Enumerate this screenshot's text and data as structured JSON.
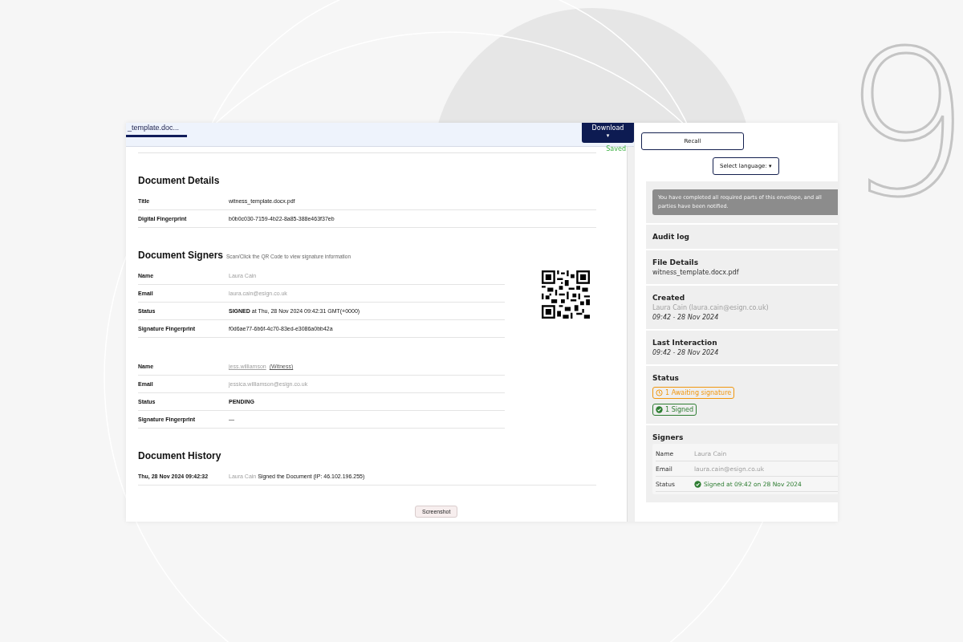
{
  "decor_digit": "9",
  "viewer": {
    "tab_label": "_template.doc...",
    "download_button": "Download",
    "caret": "▾",
    "save_state": "Saved",
    "sections": [
      {
        "kind": "details",
        "title": "Document Details",
        "rows": [
          {
            "label": "Title",
            "value": "witness_template.docx.pdf"
          },
          {
            "label": "Digital Fingerprint",
            "value": "b0b0c030-7159-4b22-8a85-388e463f37eb"
          }
        ]
      },
      {
        "kind": "signers",
        "title": "Document Signers",
        "hint": "Scan/Click the QR Code to view signature information",
        "signers": [
          {
            "qr": true,
            "rows": [
              {
                "label": "Name",
                "value": "Laura Cain",
                "muted": true
              },
              {
                "label": "Email",
                "value": "laura.cain@esign.co.uk",
                "muted": true
              },
              {
                "label": "Status",
                "value": "**SIGNED** at Thu, 28 Nov 2024 09:42:31 GMT(+0000)",
                "muted": false
              },
              {
                "label": "Signature Fingerprint",
                "value": "f0d6ae77-6b6f-4c70-83ed-e3086a0bb42a",
                "muted": false
              }
            ]
          },
          {
            "rows": [
              {
                "label": "Name",
                "value": "jess.williamson",
                "suffix": "(Witness)",
                "muted": true
              },
              {
                "label": "Email",
                "value": "jessica.williamson@esign.co.uk",
                "muted": true
              },
              {
                "label": "Status",
                "value": "**PENDING**",
                "muted": false
              },
              {
                "label": "Signature Fingerprint",
                "value": "—",
                "muted": false
              }
            ]
          }
        ]
      },
      {
        "kind": "history",
        "title": "Document History",
        "rows": [
          {
            "label": "Thu, 28 Nov 2024 09:42:32",
            "actor": "Laura Cain",
            "value": "Signed the Document (IP: 46.102.196.255)"
          }
        ]
      }
    ],
    "tooltip": "Screenshot"
  },
  "side": {
    "recall_button": "Recall",
    "language_button": "Select language:",
    "caret": "▾",
    "alert": "You have completed all required parts of this envelope, and all parties have been notified.",
    "cards": [
      {
        "kind": "heading",
        "title": "Audit log"
      },
      {
        "kind": "text",
        "title": "File Details",
        "lines": [
          {
            "text": "witness_template.docx.pdf",
            "italic": false,
            "muted": false
          }
        ]
      },
      {
        "kind": "text",
        "title": "Created",
        "lines": [
          {
            "text": "Laura Cain (laura.cain@esign.co.uk)",
            "italic": false,
            "muted": true
          },
          {
            "text": "09:42 - 28 Nov 2024",
            "italic": true,
            "muted": false
          }
        ]
      },
      {
        "kind": "text",
        "title": "Last Interaction",
        "lines": [
          {
            "text": "09:42 - 28 Nov 2024",
            "italic": true,
            "muted": false
          }
        ]
      },
      {
        "kind": "status",
        "title": "Status",
        "badges": [
          {
            "text": "1 Awaiting signature",
            "kind": "waiting"
          },
          {
            "text": "1 Signed",
            "kind": "signed"
          }
        ]
      },
      {
        "kind": "signers",
        "title": "Signers",
        "rows": [
          {
            "label": "Name",
            "value": "Laura Cain",
            "muted": true,
            "signed": false
          },
          {
            "label": "Email",
            "value": "laura.cain@esign.co.uk",
            "muted": true,
            "signed": false
          },
          {
            "label": "Status",
            "value": "Signed at 09:42 on 28 Nov 2024",
            "muted": false,
            "signed": true
          }
        ]
      }
    ]
  }
}
